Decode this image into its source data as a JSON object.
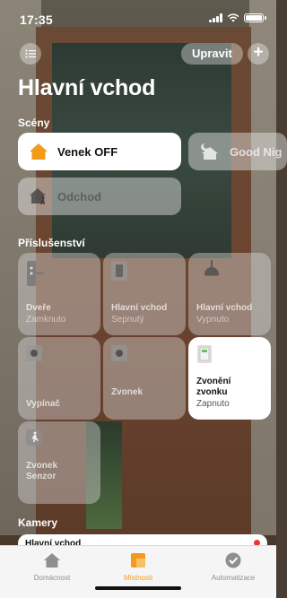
{
  "status": {
    "time": "17:35"
  },
  "toolbar": {
    "edit_label": "Upravit",
    "add_label": "+"
  },
  "room_title": "Hlavní vchod",
  "scenes": {
    "title": "Scény",
    "items": [
      {
        "label": "Venek OFF",
        "active": true
      },
      {
        "label": "Good Nig",
        "active": false
      },
      {
        "label": "Odchod",
        "active": false
      }
    ]
  },
  "accessories": {
    "title": "Příslušenství",
    "items": [
      {
        "name": "Dveře",
        "status": "Zamknuto",
        "icon": "lock-icon"
      },
      {
        "name": "Hlavní vchod",
        "status": "Sepnutý",
        "icon": "switch-icon"
      },
      {
        "name": "Hlavní vchod",
        "status": "Vypnuto",
        "icon": "lamp-icon"
      },
      {
        "name": "Vypínač",
        "status": "",
        "icon": "button-icon"
      },
      {
        "name": "Zvonek",
        "status": "",
        "icon": "button-icon"
      },
      {
        "name": "Zvonění zvonku",
        "status": "Zapnuto",
        "icon": "outlet-icon",
        "on": true
      },
      {
        "name": "Zvonek Senzor",
        "status": "",
        "icon": "motion-sensor-icon"
      }
    ]
  },
  "cameras": {
    "title": "Kamery",
    "items": [
      {
        "label": "Hlavní vchod"
      }
    ]
  },
  "tabbar": {
    "items": [
      {
        "label": "Domácnost",
        "icon": "house-icon"
      },
      {
        "label": "Místnosti",
        "icon": "rooms-icon",
        "active": true
      },
      {
        "label": "Automatizace",
        "icon": "clock-check-icon"
      }
    ]
  },
  "colors": {
    "accent": "#f39a1a",
    "scene_active_icon": "#f39a1a",
    "recording": "#e8392e"
  }
}
